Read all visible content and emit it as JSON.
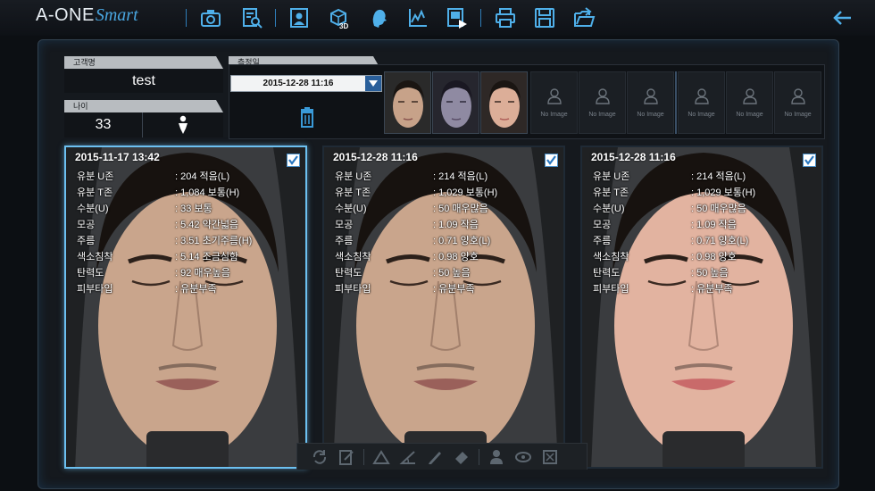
{
  "app": {
    "brand_main": "A-ONE",
    "brand_script": "Smart"
  },
  "toolbar": {
    "icons": [
      "camera-icon",
      "report-search-icon",
      "profile-compare-icon",
      "3d-view-icon",
      "face-profile-icon",
      "graph-icon",
      "video-play-icon",
      "print-icon",
      "save-icon",
      "open-folder-icon",
      "back-arrow-icon"
    ],
    "badge_3d": "3D"
  },
  "customer": {
    "name_header": "고객명",
    "name": "test",
    "age_header": "나이",
    "age": "33"
  },
  "measure": {
    "header": "측정일",
    "selected_date": "2015-12-28 11:16",
    "no_image_label": "No Image",
    "no_image_count": 6
  },
  "cards": [
    {
      "timestamp": "2015-11-17 13:42",
      "checked": true,
      "selected": true,
      "tone": "natural",
      "metrics": [
        {
          "label": "유분 U존",
          "value": ": 204 적음(L)"
        },
        {
          "label": "유분 T존",
          "value": ": 1,084 보통(H)"
        },
        {
          "label": "수분(U)",
          "value": ": 33 보통"
        },
        {
          "label": "모공",
          "value": ": 5.42 약간넓음"
        },
        {
          "label": "주름",
          "value": ": 3.51 초기주름(H)"
        },
        {
          "label": "색소침착",
          "value": ": 5.14 조금심함"
        },
        {
          "label": "탄력도",
          "value": ": 92 매우높음"
        },
        {
          "label": "피부타입",
          "value": ":  유분부족"
        }
      ]
    },
    {
      "timestamp": "2015-12-28 11:16",
      "checked": true,
      "selected": false,
      "tone": "natural",
      "metrics": [
        {
          "label": "유분 U존",
          "value": ": 214 적음(L)"
        },
        {
          "label": "유분 T존",
          "value": ": 1,029 보통(H)"
        },
        {
          "label": "수분(U)",
          "value": ": 50 매우많음"
        },
        {
          "label": "모공",
          "value": ": 1.09 작음"
        },
        {
          "label": "주름",
          "value": ": 0.71 양호(L)"
        },
        {
          "label": "색소침착",
          "value": ": 0.98 양호"
        },
        {
          "label": "탄력도",
          "value": ": 50 높음"
        },
        {
          "label": "피부타입",
          "value": ":  유분부족"
        }
      ]
    },
    {
      "timestamp": "2015-12-28 11:16",
      "checked": true,
      "selected": false,
      "tone": "warm",
      "metrics": [
        {
          "label": "유분 U존",
          "value": ": 214 적음(L)"
        },
        {
          "label": "유분 T존",
          "value": ": 1,029 보통(H)"
        },
        {
          "label": "수분(U)",
          "value": ": 50 매우많음"
        },
        {
          "label": "모공",
          "value": ": 1.09 작음"
        },
        {
          "label": "주름",
          "value": ": 0.71 양호(L)"
        },
        {
          "label": "색소침착",
          "value": ": 0.98 양호"
        },
        {
          "label": "탄력도",
          "value": ": 50 높음"
        },
        {
          "label": "피부타입",
          "value": ":  유분부족"
        }
      ]
    }
  ],
  "bottom_tools": [
    "refresh-icon",
    "edit-note-icon",
    "triangle-icon",
    "angle-icon",
    "pen-icon",
    "eraser-icon",
    "person-icon",
    "eye-outline-icon",
    "close-box-icon"
  ],
  "colors": {
    "accent": "#3a9ad8",
    "selected_border": "#6cc0f0",
    "skin_natural": "#c9a58c",
    "skin_warm": "#e2b3a0"
  }
}
